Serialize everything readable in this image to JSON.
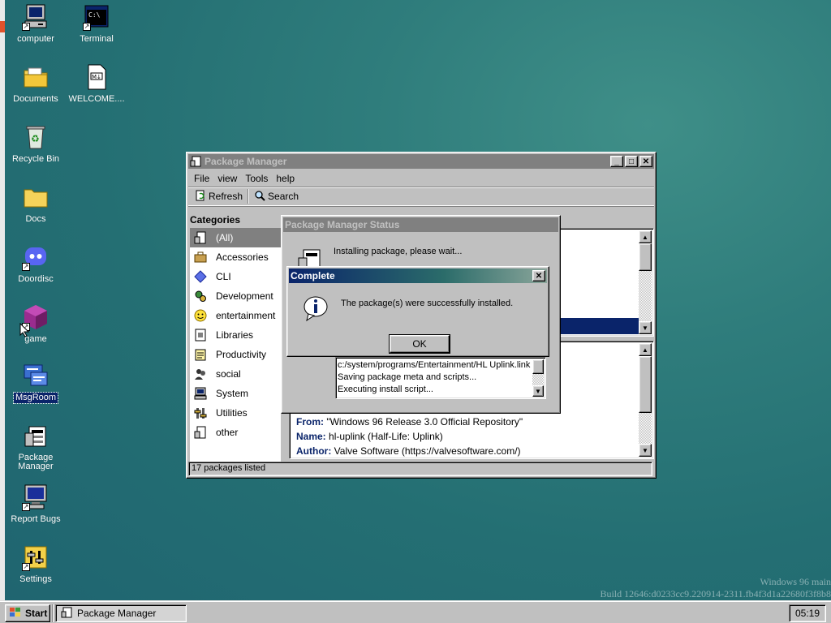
{
  "desktop": {
    "icons": [
      {
        "label": "computer",
        "icon": "computer-icon"
      },
      {
        "label": "Terminal",
        "icon": "terminal-icon"
      },
      {
        "label": "Documents",
        "icon": "documents-folder-icon"
      },
      {
        "label": "WELCOME....",
        "icon": "markdown-file-icon"
      },
      {
        "label": "Recycle Bin",
        "icon": "recycle-bin-icon"
      },
      {
        "label": "Docs",
        "icon": "folder-icon"
      },
      {
        "label": "Doordisc",
        "icon": "discord-icon"
      },
      {
        "label": "game",
        "icon": "cube-icon"
      },
      {
        "label": "MsgRoom",
        "icon": "msgroom-icon"
      },
      {
        "label": "Package Manager",
        "icon": "package-manager-icon"
      },
      {
        "label": "Report Bugs",
        "icon": "monitor-icon"
      },
      {
        "label": "Settings",
        "icon": "settings-icon"
      }
    ],
    "watermark": {
      "line1": "Windows 96 main",
      "line2": "Build 12646:d0233cc9.220914-2311.fb4f3d1a22680f3f8b8"
    }
  },
  "package_manager": {
    "title": "Package Manager",
    "menu": [
      "File",
      "view",
      "Tools",
      "help"
    ],
    "toolbar": {
      "refresh": "Refresh",
      "search": "Search"
    },
    "categories_title": "Categories",
    "categories": [
      {
        "label": "(All)",
        "icon": "package-icon",
        "selected": true
      },
      {
        "label": "Accessories",
        "icon": "briefcase-icon"
      },
      {
        "label": "CLI",
        "icon": "diamond-icon"
      },
      {
        "label": "Development",
        "icon": "gears-icon"
      },
      {
        "label": "entertainment",
        "icon": "smiley-icon"
      },
      {
        "label": "Libraries",
        "icon": "library-icon"
      },
      {
        "label": "Productivity",
        "icon": "notepad-icon"
      },
      {
        "label": "social",
        "icon": "people-icon"
      },
      {
        "label": "System",
        "icon": "computer-icon"
      },
      {
        "label": "Utilities",
        "icon": "tools-icon"
      },
      {
        "label": "other",
        "icon": "box-icon"
      }
    ],
    "details": {
      "from_label": "From:",
      "from_value": "\"Windows 96 Release 3.0 Official Repository\"",
      "name_label": "Name:",
      "name_value": "hl-uplink (Half-Life: Uplink)",
      "author_label": "Author:",
      "author_value": "Valve Software (https://valvesoftware.com/)"
    },
    "status": "17 packages listed"
  },
  "status_dialog": {
    "title": "Package Manager Status",
    "message": "Installing package, please wait...",
    "log": [
      "c:/system/programs/Entertainment/HL Uplink.link",
      "Saving package meta and scripts...",
      "Executing install script..."
    ]
  },
  "complete_dialog": {
    "title": "Complete",
    "message": "The package(s) were successfully installed.",
    "ok": "OK"
  },
  "taskbar": {
    "start": "Start",
    "task": "Package Manager",
    "clock": "05:19"
  },
  "colors": {
    "desktop": "#2f7d7c",
    "title_active": "#0a246a",
    "selection": "#0a246a",
    "face": "#c0c0c0"
  }
}
